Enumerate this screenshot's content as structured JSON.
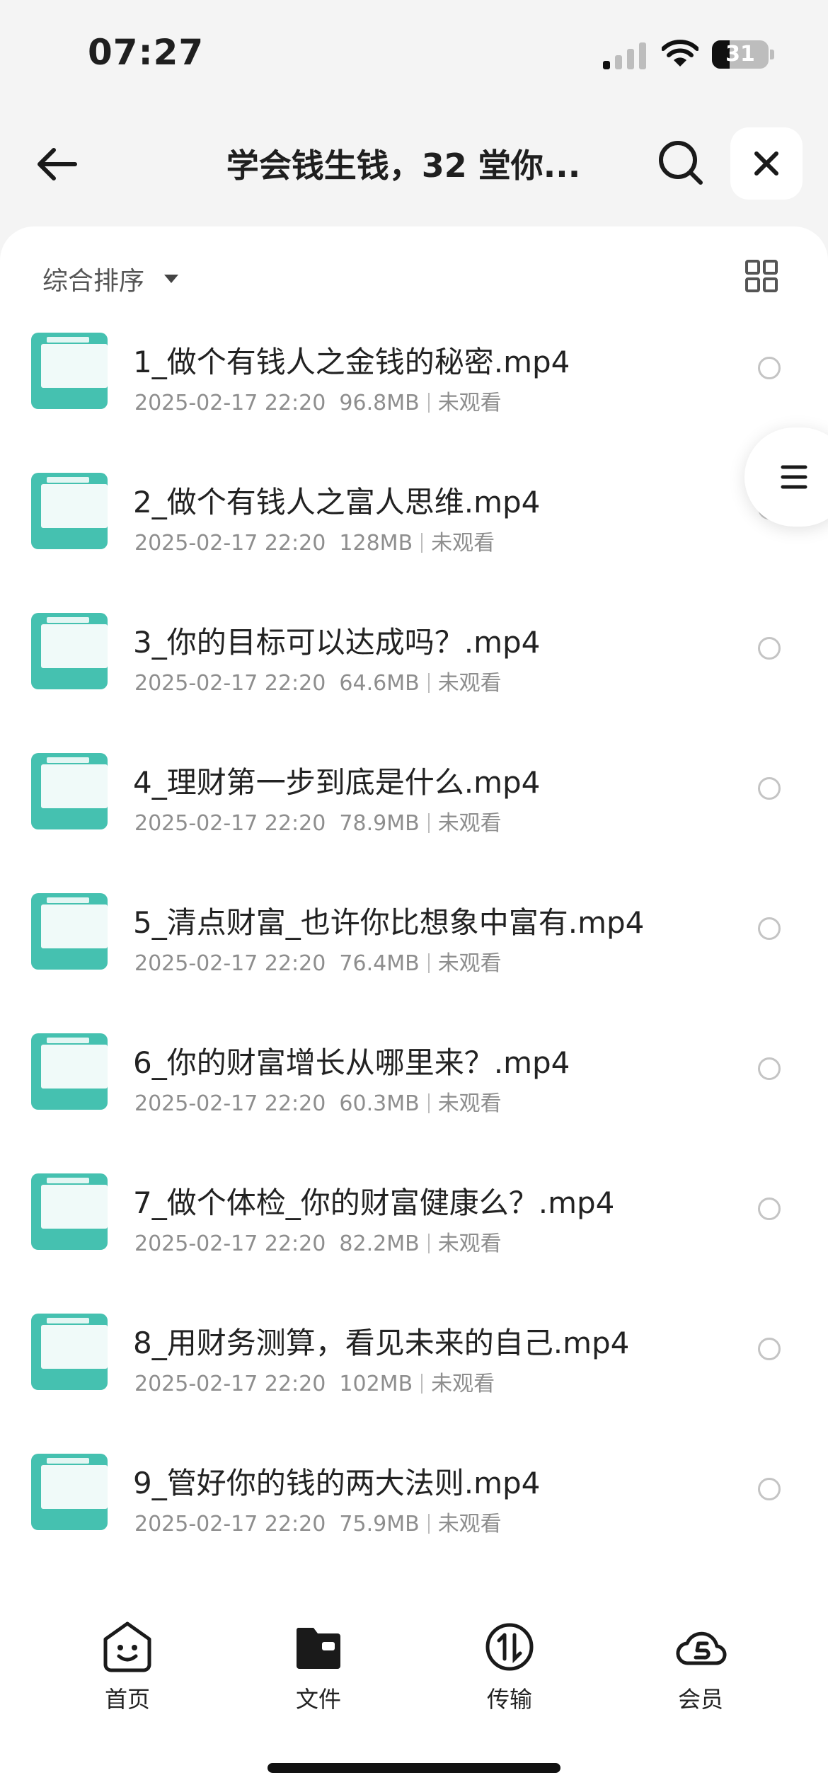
{
  "status_bar": {
    "time": "07:27",
    "battery": "31",
    "battery_level": 0.31
  },
  "header": {
    "title": "学会钱生钱，32 堂你...",
    "back_icon": "arrow-left-icon",
    "search_icon": "search-icon",
    "close_icon": "close-icon"
  },
  "toolbar": {
    "sort_label": "综合排序",
    "view_toggle_icon": "grid-view-icon"
  },
  "files": [
    {
      "name": "1_做个有钱人之金钱的秘密.mp4",
      "date": "2025-02-17 22:20",
      "size": "96.8MB",
      "status": "未观看"
    },
    {
      "name": "2_做个有钱人之富人思维.mp4",
      "date": "2025-02-17 22:20",
      "size": "128MB",
      "status": "未观看"
    },
    {
      "name": "3_你的目标可以达成吗？.mp4",
      "date": "2025-02-17 22:20",
      "size": "64.6MB",
      "status": "未观看"
    },
    {
      "name": "4_理财第一步到底是什么.mp4",
      "date": "2025-02-17 22:20",
      "size": "78.9MB",
      "status": "未观看"
    },
    {
      "name": "5_清点财富_也许你比想象中富有.mp4",
      "date": "2025-02-17 22:20",
      "size": "76.4MB",
      "status": "未观看"
    },
    {
      "name": "6_你的财富增长从哪里来？.mp4",
      "date": "2025-02-17 22:20",
      "size": "60.3MB",
      "status": "未观看"
    },
    {
      "name": "7_做个体检_你的财富健康么？.mp4",
      "date": "2025-02-17 22:20",
      "size": "82.2MB",
      "status": "未观看"
    },
    {
      "name": "8_用财务测算，看见未来的自己.mp4",
      "date": "2025-02-17 22:20",
      "size": "102MB",
      "status": "未观看"
    },
    {
      "name": "9_管好你的钱的两大法则.mp4",
      "date": "2025-02-17 22:20",
      "size": "75.9MB",
      "status": "未观看"
    }
  ],
  "float_menu_icon": "menu-lines-icon",
  "tabbar": {
    "home": "首页",
    "files": "文件",
    "transfer": "传输",
    "vip": "会员"
  }
}
